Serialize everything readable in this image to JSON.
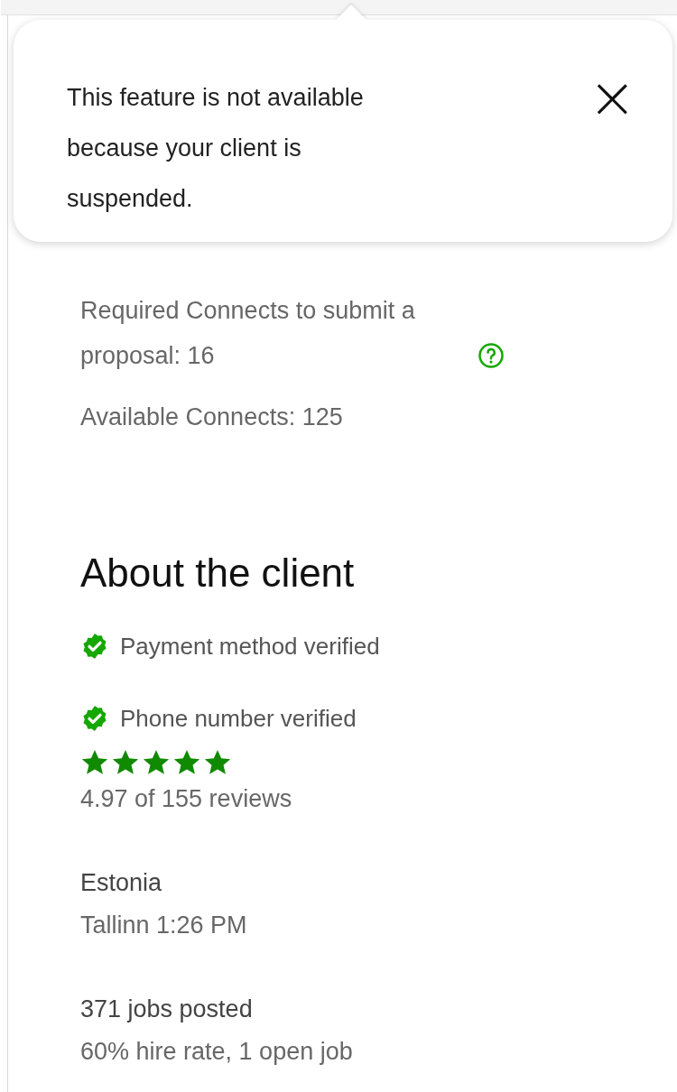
{
  "popover": {
    "message": "This feature is not available because your client is suspended.",
    "close_label": "×"
  },
  "connects": {
    "required": "Required Connects to submit a proposal: 16",
    "available": "Available Connects: 125"
  },
  "client": {
    "heading": "About the client",
    "verifications": [
      {
        "label": "Payment method verified",
        "verified": true
      },
      {
        "label": "Phone number verified",
        "verified": true
      }
    ],
    "rating": {
      "stars": 5,
      "reviews": "4.97 of 155 reviews"
    },
    "country": "Estonia",
    "local_time": "Tallinn 1:26 PM",
    "jobs_posted": "371 jobs posted",
    "hire_stats": "60% hire rate, 1 open job"
  }
}
